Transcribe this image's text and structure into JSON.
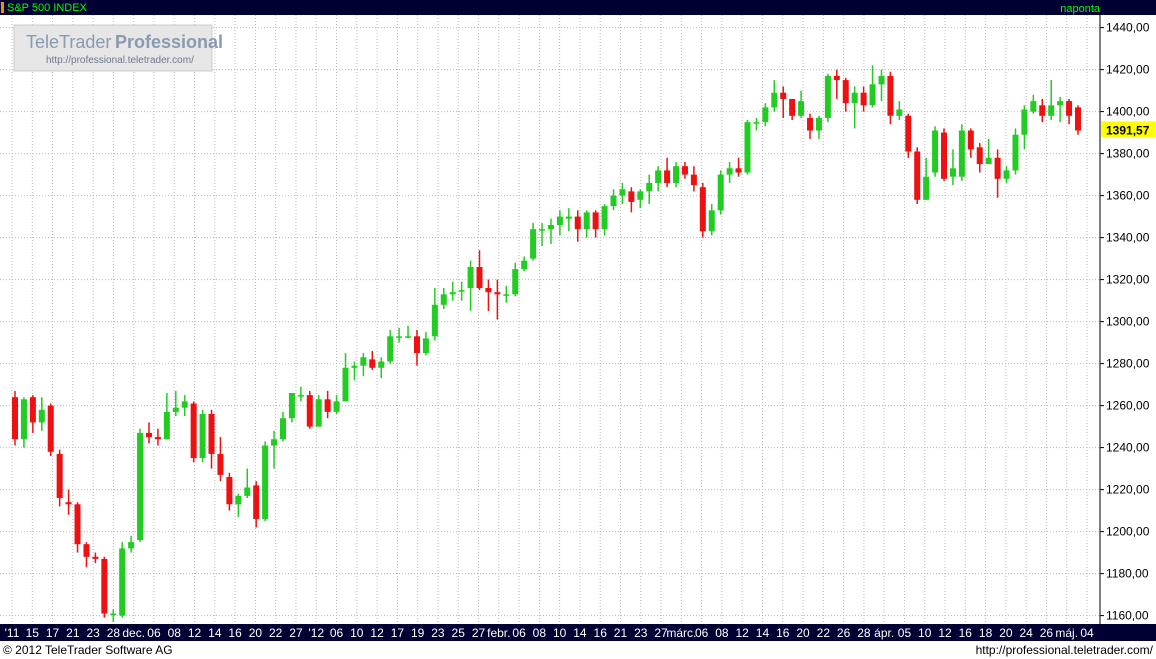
{
  "header": {
    "title": "S&P 500 INDEX",
    "period": "naponta"
  },
  "logo": {
    "brand_light": "TeleTrader",
    "brand_bold": "Professional",
    "url": "http://professional.teletrader.com/"
  },
  "footer": {
    "copyright": "© 2012 TeleTrader Software AG",
    "url": "http://professional.teletrader.com/"
  },
  "colors": {
    "up": "#22cc22",
    "down": "#ee1111",
    "header_bg": "#000033",
    "grid": "#bbbbbb",
    "last_price_bg": "#ffff00"
  },
  "chart_data": {
    "type": "candlestick",
    "title": "S&P 500 INDEX",
    "ylim": [
      1156,
      1446
    ],
    "y_ticks": [
      "1160,00",
      "1180,00",
      "1200,00",
      "1220,00",
      "1240,00",
      "1260,00",
      "1280,00",
      "1300,00",
      "1320,00",
      "1340,00",
      "1360,00",
      "1380,00",
      "1400,00",
      "1420,00",
      "1440,00"
    ],
    "last_price": "1391,57",
    "x_tick_labels": [
      "'11",
      "15",
      "17",
      "21",
      "23",
      "28",
      "dec.",
      "06",
      "08",
      "12",
      "14",
      "16",
      "20",
      "22",
      "27",
      "'12",
      "06",
      "10",
      "12",
      "17",
      "19",
      "23",
      "25",
      "27",
      "febr.",
      "06",
      "08",
      "10",
      "14",
      "16",
      "21",
      "23",
      "27",
      "márc.",
      "06",
      "08",
      "12",
      "14",
      "16",
      "20",
      "22",
      "26",
      "28",
      "ápr.",
      "05",
      "10",
      "12",
      "16",
      "18",
      "20",
      "24",
      "26",
      "máj.",
      "04"
    ],
    "candles": [
      [
        1264,
        1244,
        1267,
        1241
      ],
      [
        1244,
        1263,
        1264,
        1240
      ],
      [
        1264,
        1252,
        1265,
        1247
      ],
      [
        1252,
        1258,
        1264,
        1248
      ],
      [
        1260,
        1238,
        1261,
        1236
      ],
      [
        1237,
        1216,
        1239,
        1212
      ],
      [
        1214,
        1213,
        1220,
        1208
      ],
      [
        1213,
        1194,
        1214,
        1190
      ],
      [
        1194,
        1188,
        1195,
        1183
      ],
      [
        1188,
        1187,
        1190,
        1185
      ],
      [
        1187,
        1161,
        1188,
        1159
      ],
      [
        1161,
        1161,
        1163,
        1157
      ],
      [
        1160,
        1192,
        1195,
        1159
      ],
      [
        1192,
        1195,
        1198,
        1190
      ],
      [
        1196,
        1247,
        1249,
        1195
      ],
      [
        1247,
        1245,
        1252,
        1242
      ],
      [
        1245,
        1244,
        1249,
        1241
      ],
      [
        1244,
        1257,
        1266,
        1244
      ],
      [
        1257,
        1259,
        1267,
        1255
      ],
      [
        1259,
        1262,
        1265,
        1255
      ],
      [
        1261,
        1235,
        1262,
        1233
      ],
      [
        1235,
        1256,
        1258,
        1233
      ],
      [
        1256,
        1237,
        1258,
        1230
      ],
      [
        1237,
        1227,
        1245,
        1224
      ],
      [
        1226,
        1213,
        1228,
        1210
      ],
      [
        1213,
        1217,
        1218,
        1207
      ],
      [
        1217,
        1221,
        1230,
        1216
      ],
      [
        1222,
        1206,
        1224,
        1202
      ],
      [
        1206,
        1241,
        1243,
        1205
      ],
      [
        1241,
        1244,
        1248,
        1230
      ],
      [
        1244,
        1254,
        1257,
        1243
      ],
      [
        1254,
        1266,
        1266,
        1252
      ],
      [
        1265,
        1265,
        1269,
        1262
      ],
      [
        1265,
        1250,
        1267,
        1249
      ],
      [
        1250,
        1263,
        1265,
        1250
      ],
      [
        1263,
        1257,
        1267,
        1254
      ],
      [
        1257,
        1262,
        1265,
        1256
      ],
      [
        1262,
        1278,
        1285,
        1262
      ],
      [
        1278,
        1279,
        1281,
        1272
      ],
      [
        1279,
        1283,
        1285,
        1274
      ],
      [
        1282,
        1278,
        1286,
        1277
      ],
      [
        1278,
        1281,
        1283,
        1273
      ],
      [
        1281,
        1293,
        1296,
        1280
      ],
      [
        1293,
        1293,
        1297,
        1290
      ],
      [
        1293,
        1293,
        1298,
        1292
      ],
      [
        1293,
        1285,
        1296,
        1279
      ],
      [
        1285,
        1292,
        1295,
        1284
      ],
      [
        1293,
        1308,
        1316,
        1291
      ],
      [
        1308,
        1313,
        1316,
        1306
      ],
      [
        1313,
        1314,
        1319,
        1310
      ],
      [
        1315,
        1315,
        1319,
        1310
      ],
      [
        1316,
        1326,
        1329,
        1305
      ],
      [
        1326,
        1316,
        1334,
        1315
      ],
      [
        1316,
        1314,
        1320,
        1305
      ],
      [
        1314,
        1313,
        1320,
        1301
      ],
      [
        1313,
        1313,
        1317,
        1309
      ],
      [
        1313,
        1325,
        1328,
        1312
      ],
      [
        1325,
        1329,
        1331,
        1324
      ],
      [
        1330,
        1344,
        1347,
        1329
      ],
      [
        1344,
        1344,
        1347,
        1336
      ],
      [
        1344,
        1346,
        1349,
        1337
      ],
      [
        1346,
        1350,
        1353,
        1341
      ],
      [
        1349,
        1350,
        1354,
        1343
      ],
      [
        1350,
        1344,
        1353,
        1338
      ],
      [
        1344,
        1352,
        1353,
        1340
      ],
      [
        1352,
        1344,
        1353,
        1340
      ],
      [
        1344,
        1355,
        1356,
        1341
      ],
      [
        1355,
        1360,
        1363,
        1353
      ],
      [
        1360,
        1363,
        1366,
        1356
      ],
      [
        1362,
        1357,
        1364,
        1352
      ],
      [
        1358,
        1362,
        1363,
        1354
      ],
      [
        1362,
        1366,
        1370,
        1356
      ],
      [
        1366,
        1372,
        1374,
        1362
      ],
      [
        1372,
        1366,
        1378,
        1364
      ],
      [
        1366,
        1374,
        1376,
        1364
      ],
      [
        1374,
        1370,
        1376,
        1368
      ],
      [
        1370,
        1365,
        1374,
        1362
      ],
      [
        1364,
        1343,
        1366,
        1340
      ],
      [
        1343,
        1353,
        1356,
        1341
      ],
      [
        1353,
        1370,
        1372,
        1351
      ],
      [
        1370,
        1373,
        1376,
        1366
      ],
      [
        1373,
        1371,
        1378,
        1369
      ],
      [
        1371,
        1395,
        1396,
        1370
      ],
      [
        1395,
        1395,
        1397,
        1391
      ],
      [
        1395,
        1402,
        1404,
        1393
      ],
      [
        1402,
        1409,
        1415,
        1400
      ],
      [
        1409,
        1406,
        1412,
        1397
      ],
      [
        1406,
        1398,
        1405,
        1396
      ],
      [
        1398,
        1405,
        1410,
        1397
      ],
      [
        1397,
        1391,
        1399,
        1387
      ],
      [
        1391,
        1397,
        1398,
        1387
      ],
      [
        1397,
        1417,
        1418,
        1395
      ],
      [
        1417,
        1415,
        1420,
        1406
      ],
      [
        1415,
        1404,
        1416,
        1400
      ],
      [
        1404,
        1409,
        1412,
        1392
      ],
      [
        1409,
        1403,
        1412,
        1400
      ],
      [
        1403,
        1413,
        1422,
        1402
      ],
      [
        1413,
        1417,
        1420,
        1405
      ],
      [
        1417,
        1398,
        1419,
        1394
      ],
      [
        1398,
        1401,
        1405,
        1396
      ],
      [
        1398,
        1381,
        1399,
        1378
      ],
      [
        1381,
        1358,
        1383,
        1356
      ],
      [
        1358,
        1369,
        1378,
        1358
      ],
      [
        1371,
        1391,
        1393,
        1369
      ],
      [
        1390,
        1368,
        1392,
        1367
      ],
      [
        1369,
        1373,
        1382,
        1365
      ],
      [
        1369,
        1391,
        1394,
        1367
      ],
      [
        1391,
        1382,
        1392,
        1378
      ],
      [
        1383,
        1375,
        1385,
        1371
      ],
      [
        1375,
        1378,
        1387,
        1376
      ],
      [
        1378,
        1368,
        1382,
        1359
      ],
      [
        1368,
        1372,
        1374,
        1366
      ],
      [
        1372,
        1389,
        1392,
        1370
      ],
      [
        1389,
        1401,
        1403,
        1382
      ],
      [
        1400,
        1405,
        1408,
        1399
      ],
      [
        1403,
        1398,
        1406,
        1395
      ],
      [
        1398,
        1403,
        1415,
        1396
      ],
      [
        1403,
        1405,
        1407,
        1395
      ],
      [
        1405,
        1398,
        1406,
        1394
      ],
      [
        1402,
        1391,
        1403,
        1389
      ]
    ]
  }
}
